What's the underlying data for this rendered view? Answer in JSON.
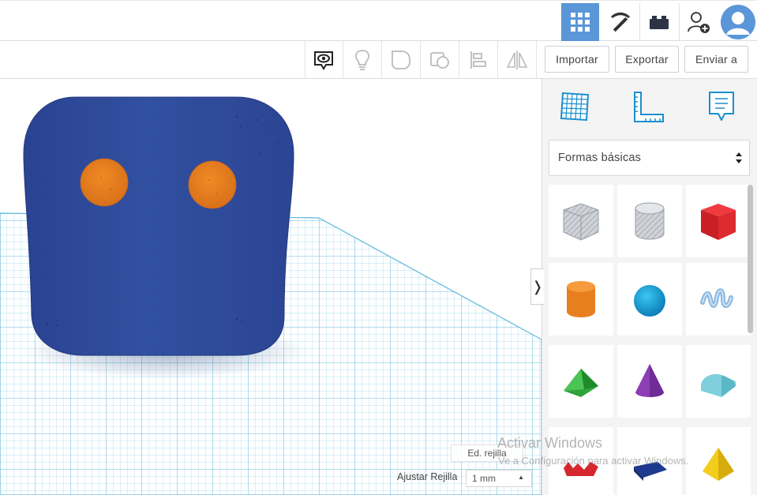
{
  "topbar": {
    "buttons": [
      {
        "icon": "3d-design-grid-icon",
        "active": true
      },
      {
        "icon": "pickaxe-icon",
        "active": false
      },
      {
        "icon": "brick-icon",
        "active": false
      },
      {
        "icon": "add-user-icon",
        "active": false
      },
      {
        "icon": "user-avatar-icon",
        "active": false
      }
    ]
  },
  "toolbar": {
    "tools": [
      "notes-visibility-icon",
      "lightbulb-icon",
      "group-icon",
      "ungroup-icon",
      "align-icon",
      "mirror-icon"
    ],
    "import_label": "Importar",
    "export_label": "Exportar",
    "send_label": "Enviar a"
  },
  "panel": {
    "icons": [
      "workplane-icon",
      "ruler-icon",
      "notes-icon"
    ],
    "shape_library": "Formas básicas",
    "shapes": [
      {
        "icon": "box-hole-icon"
      },
      {
        "icon": "cylinder-hole-icon"
      },
      {
        "icon": "box-icon"
      },
      {
        "icon": "cylinder-icon"
      },
      {
        "icon": "sphere-icon"
      },
      {
        "icon": "scribble-icon"
      },
      {
        "icon": "roof-icon"
      },
      {
        "icon": "cone-icon"
      },
      {
        "icon": "round-roof-icon"
      },
      {
        "icon": "text-icon"
      },
      {
        "icon": "wedge-icon"
      },
      {
        "icon": "pyramid-icon"
      }
    ]
  },
  "workplane": {
    "edit_grid_label": "Ed. rejilla",
    "snap_label": "Ajustar Rejilla",
    "snap_value": "1 mm"
  },
  "watermark": {
    "title": "Activar Windows",
    "subtitle": "Ve a Configuración para activar Windows."
  },
  "colors": {
    "accent": "#5a96d8",
    "body_blue": "#2e4a9e",
    "eye_orange": "#e8821e",
    "grid_blue": "#7cc8e6"
  }
}
